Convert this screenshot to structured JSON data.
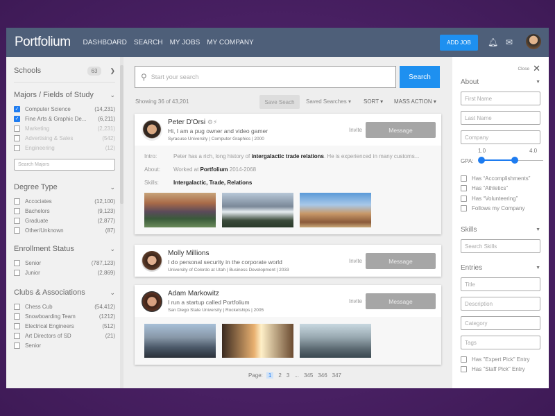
{
  "header": {
    "logo": "Portfolium",
    "nav": [
      "DASHBOARD",
      "SEARCH",
      "MY JOBS",
      "MY COMPANY"
    ],
    "add_job": "ADD JOB"
  },
  "colors": {
    "header": "#4e5f79",
    "accent": "#1e90f0",
    "background": "#4a2064"
  },
  "sidebar": {
    "schools": {
      "label": "Schools",
      "count": "63"
    },
    "majors": {
      "title": "Majors / Fields of Study",
      "search_placeholder": "Search Majors",
      "items": [
        {
          "label": "Computer Science",
          "count": "(14,231)",
          "checked": true
        },
        {
          "label": "Fine Arts & Graphic De...",
          "count": "(6,211)",
          "checked": true
        },
        {
          "label": "Marketing",
          "count": "(2,231)",
          "checked": false
        },
        {
          "label": "Advertising & Sales",
          "count": "(542)",
          "checked": false
        },
        {
          "label": "Engineering",
          "count": "(12)",
          "checked": false
        }
      ]
    },
    "degree": {
      "title": "Degree Type",
      "items": [
        {
          "label": "Accociates",
          "count": "(12,100)"
        },
        {
          "label": "Bachelors",
          "count": "(9,123)"
        },
        {
          "label": "Graduate",
          "count": "(2,877)"
        },
        {
          "label": "Other/Unknown",
          "count": "(87)"
        }
      ]
    },
    "enrollment": {
      "title": "Enrollment Status",
      "items": [
        {
          "label": "Senior",
          "count": "(787,123)"
        },
        {
          "label": "Junior",
          "count": "(2,869)"
        }
      ]
    },
    "clubs": {
      "title": "Clubs & Associations",
      "items": [
        {
          "label": "Chess Cub",
          "count": "(54,412)"
        },
        {
          "label": "Snowboarding Team",
          "count": "(1212)"
        },
        {
          "label": "Electrical Engineers",
          "count": "(512)"
        },
        {
          "label": "Art Directors of SD",
          "count": "(21)"
        },
        {
          "label": "Senior",
          "count": ""
        }
      ]
    }
  },
  "search": {
    "placeholder": "Start your search",
    "button": "Search"
  },
  "toolbar": {
    "showing": "Showing 36 of 43,201",
    "save": "Save Seach",
    "saved": "Saved Searches",
    "sort": "SORT",
    "mass": "MASS ACTION"
  },
  "results": [
    {
      "name": "Peter D'Orsi",
      "tagline": "Hi, I am a pug owner and video gamer",
      "meta": "Syracuse University | Computer Graphics | 2000",
      "invite": "Invite",
      "message": "Message",
      "intro_label": "Intro:",
      "intro_pre": "Peter has a rich, long history of ",
      "intro_bold": "intergalactic trade relations",
      "intro_post": ". He is experienced in many customs...",
      "about_label": "About:",
      "about_pre": "Worked at ",
      "about_bold": "Portfolium",
      "about_post": " 2014-2068",
      "skills_label": "Skills:",
      "skills": "Intergalactic, Trade, Relations"
    },
    {
      "name": "Molly Millions",
      "tagline": "I do personal security in the corporate world",
      "meta": "University of Colordo at Utah | Business Development | 2033",
      "invite": "Invite",
      "message": "Message"
    },
    {
      "name": "Adam Markowitz",
      "tagline": "I run a startup called Portfolium",
      "meta": "San Diego State University | Rocketships | 2005",
      "invite": "Invite",
      "message": "Message"
    }
  ],
  "pagination": {
    "label": "Page:",
    "pages": [
      "1",
      "2",
      "3",
      "...",
      "345",
      "346",
      "347"
    ],
    "current": "1"
  },
  "filters": {
    "close": "Close",
    "about": "About",
    "first": "First Name",
    "last": "Last Name",
    "company": "Company",
    "gpa_label": "GPA:",
    "gpa_min": "1.0",
    "gpa_max": "4.0",
    "checks": [
      "Has “Accomplishments”",
      "Has “Athletics”",
      "Has “Volunteering”",
      "Follows my Company"
    ],
    "skills": "Skills",
    "skills_placeholder": "Search Skills",
    "entries": "Entries",
    "entry_fields": [
      "Title",
      "Description",
      "Category",
      "Tags"
    ],
    "entry_checks": [
      "Has \"Expert Pick\" Entry",
      "Has \"Staff Pick\" Entry"
    ]
  }
}
